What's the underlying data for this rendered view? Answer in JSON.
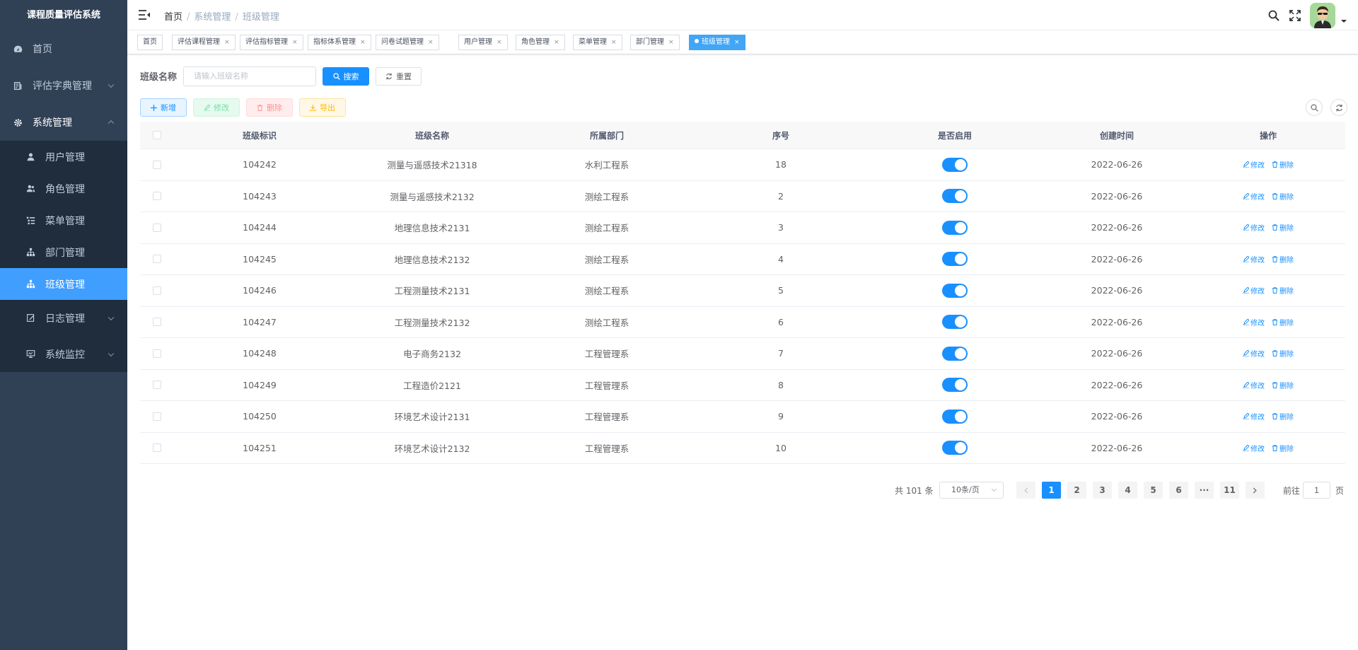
{
  "app_title": "课程质量评估系统",
  "sidebar": {
    "items": [
      {
        "label": "首页",
        "icon": "dashboard-icon"
      },
      {
        "label": "评估字典管理",
        "icon": "dictionary-icon"
      },
      {
        "label": "系统管理",
        "icon": "gear-icon"
      }
    ],
    "system_sub": [
      {
        "label": "用户管理",
        "icon": "user-icon"
      },
      {
        "label": "角色管理",
        "icon": "peoples-icon"
      },
      {
        "label": "菜单管理",
        "icon": "tree-table-icon"
      },
      {
        "label": "部门管理",
        "icon": "tree-icon"
      },
      {
        "label": "班级管理",
        "icon": "tree-icon",
        "active": true
      }
    ],
    "after": [
      {
        "label": "日志管理",
        "icon": "log-icon"
      },
      {
        "label": "系统监控",
        "icon": "monitor-icon"
      }
    ]
  },
  "breadcrumb": [
    "首页",
    "系统管理",
    "班级管理"
  ],
  "tags": [
    "首页",
    "评估课程管理",
    "评估指标管理",
    "指标体系管理",
    "问卷试题管理",
    "用户管理",
    "角色管理",
    "菜单管理",
    "部门管理",
    "班级管理"
  ],
  "search": {
    "label": "班级名称",
    "placeholder": "请输入班级名称",
    "search_btn": "搜索",
    "reset_btn": "重置"
  },
  "toolbar": {
    "add": "新增",
    "edit": "修改",
    "delete": "删除",
    "export": "导出"
  },
  "table": {
    "columns": [
      "班级标识",
      "班级名称",
      "所属部门",
      "序号",
      "是否启用",
      "创建时间",
      "操作"
    ],
    "rows": [
      {
        "id": "104242",
        "name": "测量与遥感技术21318",
        "dept": "水利工程系",
        "order": "18",
        "enabled": true,
        "created": "2022-06-26"
      },
      {
        "id": "104243",
        "name": "测量与遥感技术2132",
        "dept": "测绘工程系",
        "order": "2",
        "enabled": true,
        "created": "2022-06-26"
      },
      {
        "id": "104244",
        "name": "地理信息技术2131",
        "dept": "测绘工程系",
        "order": "3",
        "enabled": true,
        "created": "2022-06-26"
      },
      {
        "id": "104245",
        "name": "地理信息技术2132",
        "dept": "测绘工程系",
        "order": "4",
        "enabled": true,
        "created": "2022-06-26"
      },
      {
        "id": "104246",
        "name": "工程测量技术2131",
        "dept": "测绘工程系",
        "order": "5",
        "enabled": true,
        "created": "2022-06-26"
      },
      {
        "id": "104247",
        "name": "工程测量技术2132",
        "dept": "测绘工程系",
        "order": "6",
        "enabled": true,
        "created": "2022-06-26"
      },
      {
        "id": "104248",
        "name": "电子商务2132",
        "dept": "工程管理系",
        "order": "7",
        "enabled": true,
        "created": "2022-06-26"
      },
      {
        "id": "104249",
        "name": "工程造价2121",
        "dept": "工程管理系",
        "order": "8",
        "enabled": true,
        "created": "2022-06-26"
      },
      {
        "id": "104250",
        "name": "环境艺术设计2131",
        "dept": "工程管理系",
        "order": "9",
        "enabled": true,
        "created": "2022-06-26"
      },
      {
        "id": "104251",
        "name": "环境艺术设计2132",
        "dept": "工程管理系",
        "order": "10",
        "enabled": true,
        "created": "2022-06-26"
      }
    ],
    "op_edit": "修改",
    "op_delete": "删除"
  },
  "pagination": {
    "total": "共 101 条",
    "page_size": "10条/页",
    "pages": [
      "1",
      "2",
      "3",
      "4",
      "5",
      "6",
      "···",
      "11"
    ],
    "current": "1",
    "goto_label": "前往",
    "goto_value": "1",
    "goto_suffix": "页"
  },
  "colors": {
    "primary": "#1890ff",
    "sidebar_bg": "#304156",
    "submenu_bg": "#1f2d3d",
    "active_menu": "#409eff"
  }
}
